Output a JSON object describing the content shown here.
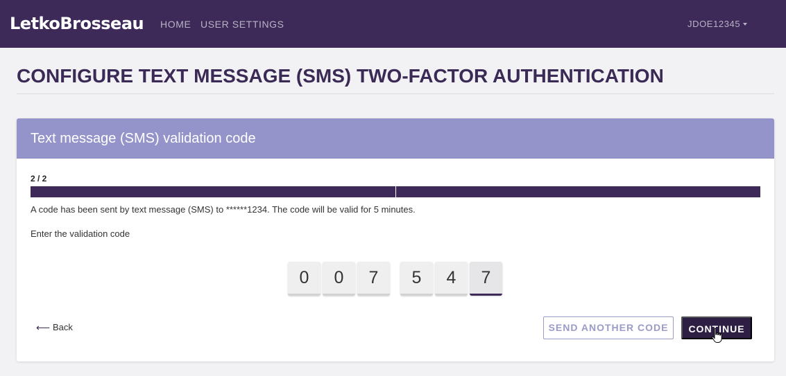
{
  "nav": {
    "brand": "LetkoBrosseau",
    "links": [
      {
        "label": "HOME"
      },
      {
        "label": "USER SETTINGS"
      }
    ],
    "user": "JDOE12345"
  },
  "page": {
    "title": "CONFIGURE TEXT MESSAGE (SMS) TWO-FACTOR AUTHENTICATION"
  },
  "card": {
    "title": "Text message (SMS) validation code",
    "step": "2 / 2",
    "progress": {
      "current": 2,
      "total": 2
    },
    "info": "A code has been sent by text message (SMS) to ******1234. The code will be valid for 5 minutes.",
    "prompt": "Enter the validation code",
    "code": [
      "0",
      "0",
      "7",
      "5",
      "4",
      "7"
    ],
    "back_label": "Back",
    "resend_label": "SEND ANOTHER CODE",
    "continue_label": "CONTINUE"
  },
  "colors": {
    "navbar": "#3d2a58",
    "card_header": "#9494cb",
    "progress": "#3d2a58",
    "continue_button": "#2d1e44",
    "resend_border": "#9b9bc8"
  },
  "icons": {
    "back": "arrow-left-icon",
    "user_menu": "caret-down-icon",
    "pointer": "hand-pointer-icon"
  }
}
